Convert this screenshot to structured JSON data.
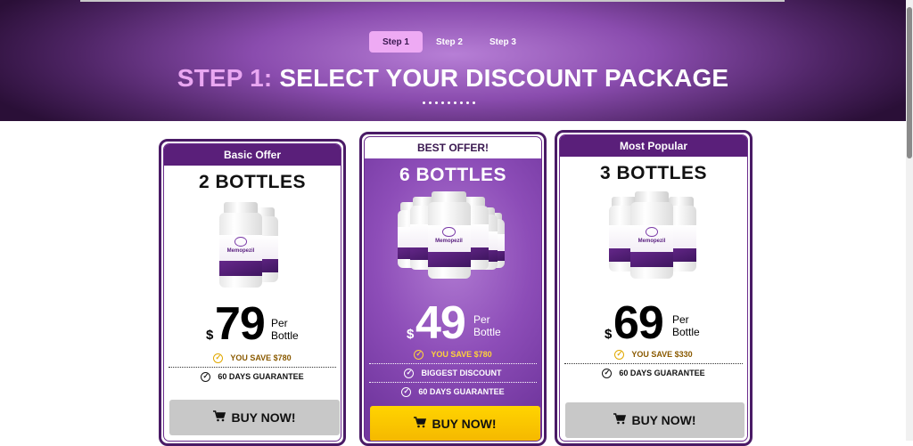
{
  "hero": {
    "steps": [
      "Step 1",
      "Step 2",
      "Step 3"
    ],
    "title_highlight": "STEP 1:",
    "title_rest": " SELECT YOUR DISCOUNT PACKAGE"
  },
  "cards": [
    {
      "header": "Basic Offer",
      "title": "2 BOTTLES",
      "price_symbol": "$",
      "price": "79",
      "per": "Per",
      "bottle": "Bottle",
      "lines": [
        "YOU SAVE $780",
        "60 DAYS GUARANTEE"
      ],
      "buy_label": "BUY NOW!",
      "product_label": "Memopezil"
    },
    {
      "header": "BEST OFFER!",
      "title": "6 BOTTLES",
      "price_symbol": "$",
      "price": "49",
      "per": "Per",
      "bottle": "Bottle",
      "lines": [
        "YOU SAVE $780",
        "BIGGEST DISCOUNT",
        "60 DAYS GUARANTEE"
      ],
      "buy_label": "BUY NOW!",
      "product_label": "Memopezil"
    },
    {
      "header": "Most Popular",
      "title": "3 BOTTLES",
      "price_symbol": "$",
      "price": "69",
      "per": "Per",
      "bottle": "Bottle",
      "lines": [
        "YOU SAVE $330",
        "60 DAYS GUARANTEE"
      ],
      "buy_label": "BUY NOW!",
      "product_label": "Memopezil"
    }
  ],
  "colors": {
    "brand_purple": "#5a1f7a",
    "accent_pink": "#eaa7f2",
    "save_gold": "#e0a800",
    "buy_yellow": "#ffc800",
    "buy_gray": "#c8c8c8"
  },
  "icons": [
    "check-circle-icon",
    "cart-icon"
  ]
}
